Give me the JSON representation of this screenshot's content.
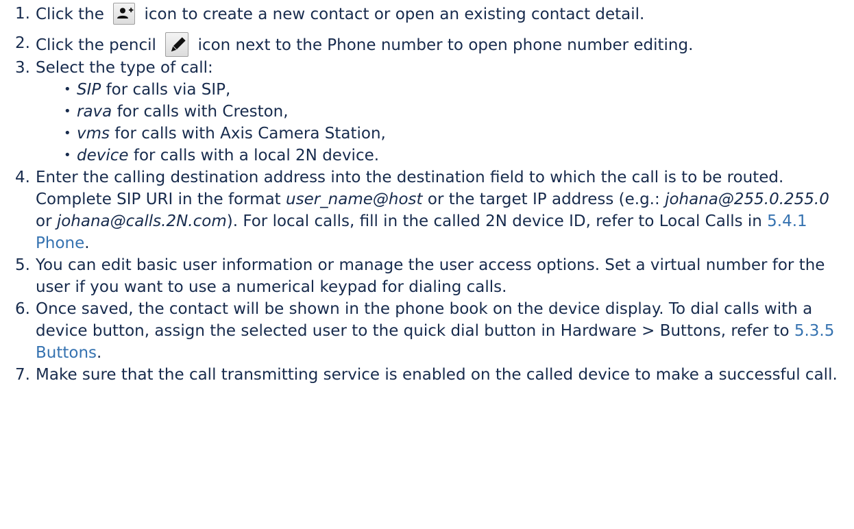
{
  "steps": [
    {
      "number": "1.",
      "before": "Click the",
      "icon": "add-user-icon",
      "after": "icon to create a new contact or open an existing contact detail."
    },
    {
      "number": "2.",
      "before": "Click the pencil",
      "icon": "pencil-icon",
      "after": "icon next to the Phone number to open phone number editing."
    },
    {
      "number": "3.",
      "text": "Select the type of call:",
      "bullets": [
        {
          "term": "SIP",
          "text": " for calls via SIP,"
        },
        {
          "term": "rava",
          "text": " for calls with Creston,"
        },
        {
          "term": "vms",
          "text": " for calls with Axis Camera Station,"
        },
        {
          "term": "device",
          "text": " for calls with a local 2N device."
        }
      ]
    },
    {
      "number": "4.",
      "text": "Enter the calling destination address into the destination field to which the call is to be routed.",
      "detail_a": "Complete SIP URI in the format ",
      "detail_format": "user_name@host",
      "detail_b": " or the target IP address (e.g.: ",
      "example_ip": "johana@255.0.255.0",
      "detail_or": " or ",
      "example_host": "johana@calls.2N.com",
      "detail_c": "). For local calls, fill in the called 2N device ID, refer to Local Calls in ",
      "link": "5.4.1 Phone",
      "detail_end": "."
    },
    {
      "number": "5.",
      "text": "You can edit basic user information or manage the user access options. Set a virtual number for the user if you want to use a numerical keypad for dialing calls."
    },
    {
      "number": "6.",
      "text": "Once saved, the contact will be shown in the phone book on the device display. To dial calls with a device button, assign the selected user to the quick dial button in Hardware > Buttons, refer to ",
      "link": "5.3.5 Buttons",
      "end": "."
    },
    {
      "number": "7.",
      "text": "Make sure that the call transmitting service is enabled on the called device to make a successful call."
    }
  ],
  "colors": {
    "text": "#172b4d",
    "link": "#3572b0"
  }
}
